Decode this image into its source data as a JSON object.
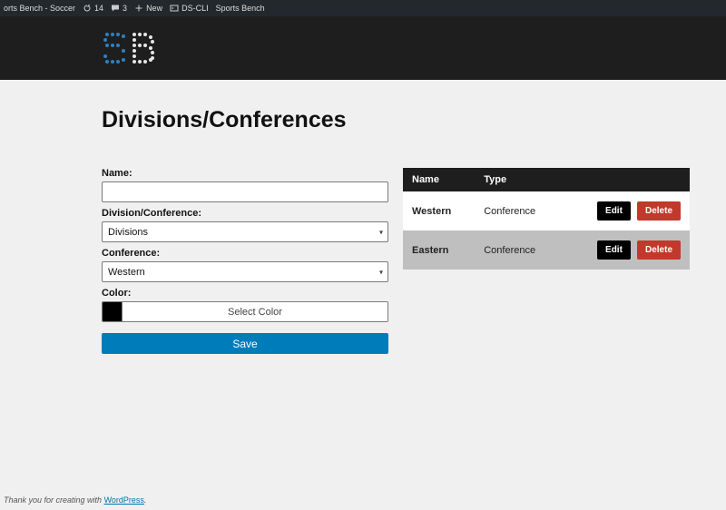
{
  "adminbar": {
    "site": "orts Bench - Soccer",
    "updates": "14",
    "comments": "3",
    "new": "New",
    "dscli": "DS-CLI",
    "sb": "Sports Bench"
  },
  "page_title": "Divisions/Conferences",
  "form": {
    "name_label": "Name:",
    "name_value": "",
    "divconf_label": "Division/Conference:",
    "divconf_value": "Divisions",
    "conference_label": "Conference:",
    "conference_value": "Western",
    "color_label": "Color:",
    "select_color": "Select Color",
    "save": "Save"
  },
  "table": {
    "headers": {
      "name": "Name",
      "type": "Type"
    },
    "rows": [
      {
        "name": "Western",
        "type": "Conference"
      },
      {
        "name": "Eastern",
        "type": "Conference"
      }
    ],
    "edit": "Edit",
    "delete": "Delete"
  },
  "footer": {
    "thanks": "Thank you for creating with ",
    "wp": "WordPress",
    "dot": "."
  }
}
